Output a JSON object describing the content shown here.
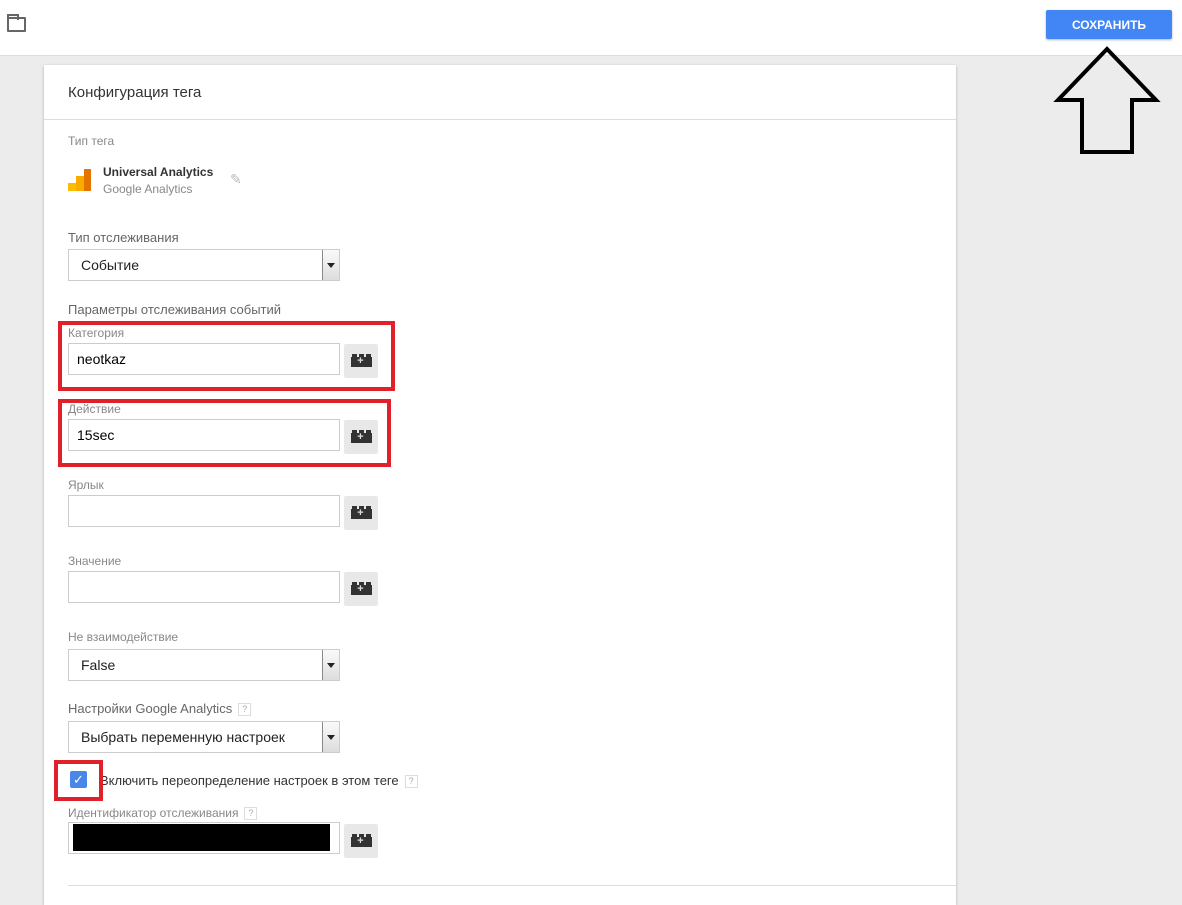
{
  "toolbar": {
    "save_label": "СОХРАНИТЬ"
  },
  "card": {
    "title": "Конфигурация тега",
    "tag_type_label": "Тип тега",
    "tag_type_name": "Universal Analytics",
    "tag_type_vendor": "Google Analytics",
    "tracking_type_label": "Тип отслеживания",
    "tracking_type_value": "Событие",
    "event_params_label": "Параметры отслеживания событий",
    "category_label": "Категория",
    "category_value": "neotkaz",
    "action_label": "Действие",
    "action_value": "15sec",
    "label_label": "Ярлык",
    "label_value": "",
    "value_label": "Значение",
    "value_value": "",
    "non_interaction_label": "Не взаимодействие",
    "non_interaction_value": "False",
    "ga_settings_label": "Настройки Google Analytics",
    "ga_settings_value": "Выбрать переменную настроек",
    "override_label": "Включить переопределение настроек в этом теге",
    "override_checked": true,
    "tracking_id_label": "Идентификатор отслеживания",
    "help_glyph": "?"
  },
  "colors": {
    "accent": "#4285f4",
    "highlight": "#e0202a"
  }
}
